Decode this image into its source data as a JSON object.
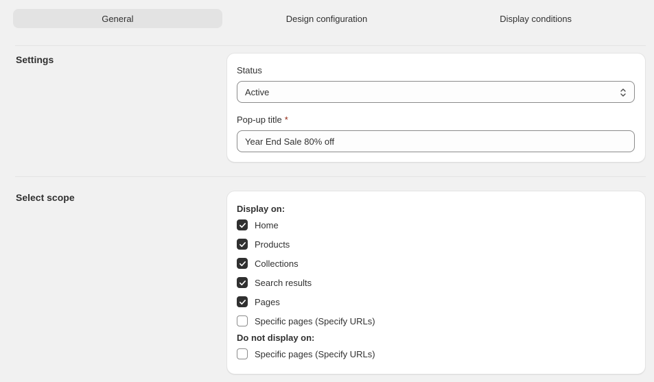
{
  "tabs": [
    {
      "label": "General",
      "active": true
    },
    {
      "label": "Design configuration",
      "active": false
    },
    {
      "label": "Display conditions",
      "active": false
    }
  ],
  "settings": {
    "title": "Settings",
    "status_label": "Status",
    "status_value": "Active",
    "popup_title_label": "Pop-up title",
    "required_mark": "*",
    "popup_title_value": "Year End Sale 80% off"
  },
  "scope": {
    "title": "Select scope",
    "display_on_label": "Display on:",
    "display_on": [
      {
        "label": "Home",
        "checked": true
      },
      {
        "label": "Products",
        "checked": true
      },
      {
        "label": "Collections",
        "checked": true
      },
      {
        "label": "Search results",
        "checked": true
      },
      {
        "label": "Pages",
        "checked": true
      },
      {
        "label": "Specific pages (Specify URLs)",
        "checked": false
      }
    ],
    "do_not_display_label": "Do not display on:",
    "do_not_display": [
      {
        "label": "Specific pages (Specify URLs)",
        "checked": false
      }
    ]
  },
  "icons": {
    "select": "chevron-up-down-icon",
    "check": "checkmark-icon"
  },
  "colors": {
    "background": "#f1f1f1",
    "card": "#ffffff",
    "active_tab": "#e3e3e3",
    "checkbox_checked": "#303030",
    "required": "#8e1f0b"
  }
}
